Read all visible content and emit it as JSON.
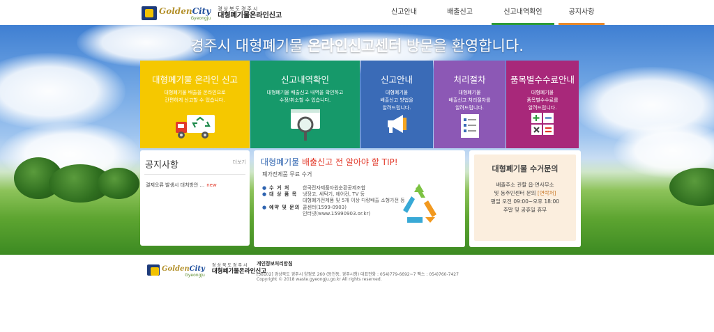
{
  "header": {
    "logo_golden": "Golden",
    "logo_city": "City",
    "logo_sub": "Gyeongju",
    "logo_small": "경상북도경주시",
    "logo_big": "대형폐기물온라인신고",
    "nav": [
      {
        "label": "신고안내",
        "bar": ""
      },
      {
        "label": "배출신고",
        "bar": ""
      },
      {
        "label": "신고내역확인",
        "bar": "#2e9a3a"
      },
      {
        "label": "공지사항",
        "bar": "#e8892c"
      }
    ]
  },
  "hero": {
    "welcome_pre": "경주시 대형폐기물 ",
    "welcome_bold": "온라인신고센터",
    "welcome_post": " 방문을 환영합니다."
  },
  "tiles": [
    {
      "title": "대형폐기물 온라인 신고",
      "desc": [
        "대형폐기물 배출을 온라인으로",
        "간편하게 신고할 수 있습니다."
      ],
      "color": "#f5c800",
      "icon": "truck-recycle-icon"
    },
    {
      "title": "신고내역확인",
      "desc": [
        "대형폐기물 배출신고 내역을 확인하고",
        "수정/취소할 수 있습니다."
      ],
      "color": "#16996a",
      "icon": "magnifier-screen-icon"
    },
    {
      "title": "신고안내",
      "desc": [
        "대형폐기물",
        "배출신고 방법을",
        "알려드립니다."
      ],
      "color": "#3a6bb7",
      "icon": "megaphone-icon"
    },
    {
      "title": "처리절차",
      "desc": [
        "대형폐기물",
        "배출신고 처리절차를",
        "알려드립니다."
      ],
      "color": "#8c58b5",
      "icon": "checklist-icon"
    },
    {
      "title": "품목별수수료안내",
      "desc": [
        "대형폐기물",
        "품목별수수료를",
        "알려드립니다."
      ],
      "color": "#a8287a",
      "icon": "calculator-icon"
    }
  ],
  "notice": {
    "title": "공지사항",
    "more": "더보기",
    "items": [
      {
        "text": "결제오류 발생시 대처방안 ...",
        "badge": "new"
      }
    ]
  },
  "tip": {
    "title_pre": "대형폐기물 ",
    "title_hl": "배출신고 전 알아야 할 TIP!",
    "subtitle": "폐가전제품 무료 수거",
    "rows": [
      {
        "label": "수 거 처",
        "lines": [
          "한국전자제품자원순환공제조합"
        ]
      },
      {
        "label": "대 상 품 목",
        "lines": [
          "냉장고, 세탁기, 에어컨, TV 등",
          "대형폐가전제품 및 5개 이상 다량배출 소형가전 등"
        ]
      },
      {
        "label": "예약 및 문의",
        "lines": [
          "콜센터(1599-0903)",
          "인터넷(www.15990903.or.kr)"
        ]
      }
    ]
  },
  "inquiry": {
    "title": "대형폐기물 수거문의",
    "line1": "배출주소 관할 읍·면사무소",
    "line2_pre": "및 동주민센터 문의 ",
    "line2_em": "[연락처]",
    "line3": "평일 오전 09:00~오후 18:00",
    "line4": "주말 및 공휴일 휴무"
  },
  "footer": {
    "logo_golden": "Golden",
    "logo_city": "City",
    "logo_sub": "Gyeongju",
    "logo_small": "경상북도경주시",
    "logo_big": "대형폐기물온라인신고",
    "privacy": "개인정보처리방침",
    "address": "[38102] 경상북도 경주시 양정로 260 (동천동, 경주시청) 대표전화 : 054)779-6692~7 팩스 : 054)760-7427",
    "copyright": "Copyright © 2018 waste.gyeongju.go.kr All rights reserved."
  },
  "colors": {
    "accent_blue": "#2f64b0",
    "accent_red": "#e23a2b"
  }
}
